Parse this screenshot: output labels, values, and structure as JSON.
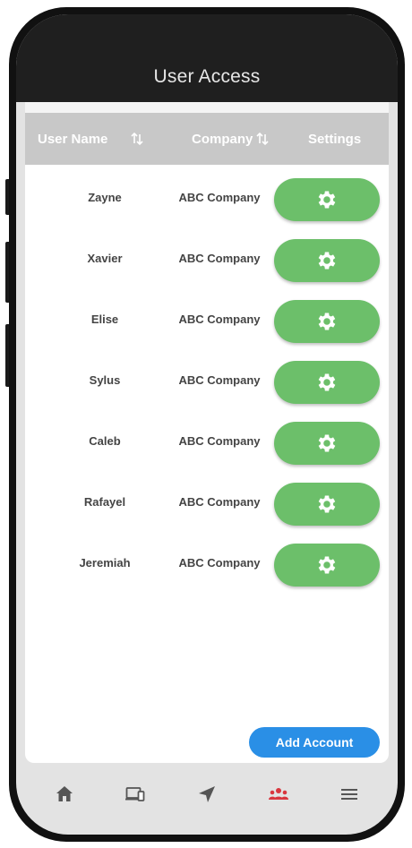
{
  "header": {
    "title": "User Access"
  },
  "table": {
    "columns": {
      "user_name": "User Name",
      "company": "Company",
      "settings": "Settings"
    },
    "rows": [
      {
        "name": "Zayne",
        "company": "ABC Company"
      },
      {
        "name": "Xavier",
        "company": "ABC Company"
      },
      {
        "name": "Elise",
        "company": "ABC Company"
      },
      {
        "name": "Sylus",
        "company": "ABC Company"
      },
      {
        "name": "Caleb",
        "company": "ABC Company"
      },
      {
        "name": "Rafayel",
        "company": "ABC Company"
      },
      {
        "name": "Jeremiah",
        "company": "ABC Company"
      }
    ],
    "settings_icon": "gear-icon"
  },
  "actions": {
    "add_account": "Add Account"
  },
  "nav": {
    "items": [
      {
        "icon": "home-icon",
        "active": false
      },
      {
        "icon": "devices-icon",
        "active": false
      },
      {
        "icon": "location-arrow-icon",
        "active": false
      },
      {
        "icon": "users-icon",
        "active": true
      },
      {
        "icon": "menu-icon",
        "active": false
      }
    ],
    "active_color": "#d9363e",
    "inactive_color": "#555555"
  },
  "colors": {
    "accent_green": "#6cbf6a",
    "accent_blue": "#2a8fe6",
    "header_bg": "#1f1f1f"
  }
}
